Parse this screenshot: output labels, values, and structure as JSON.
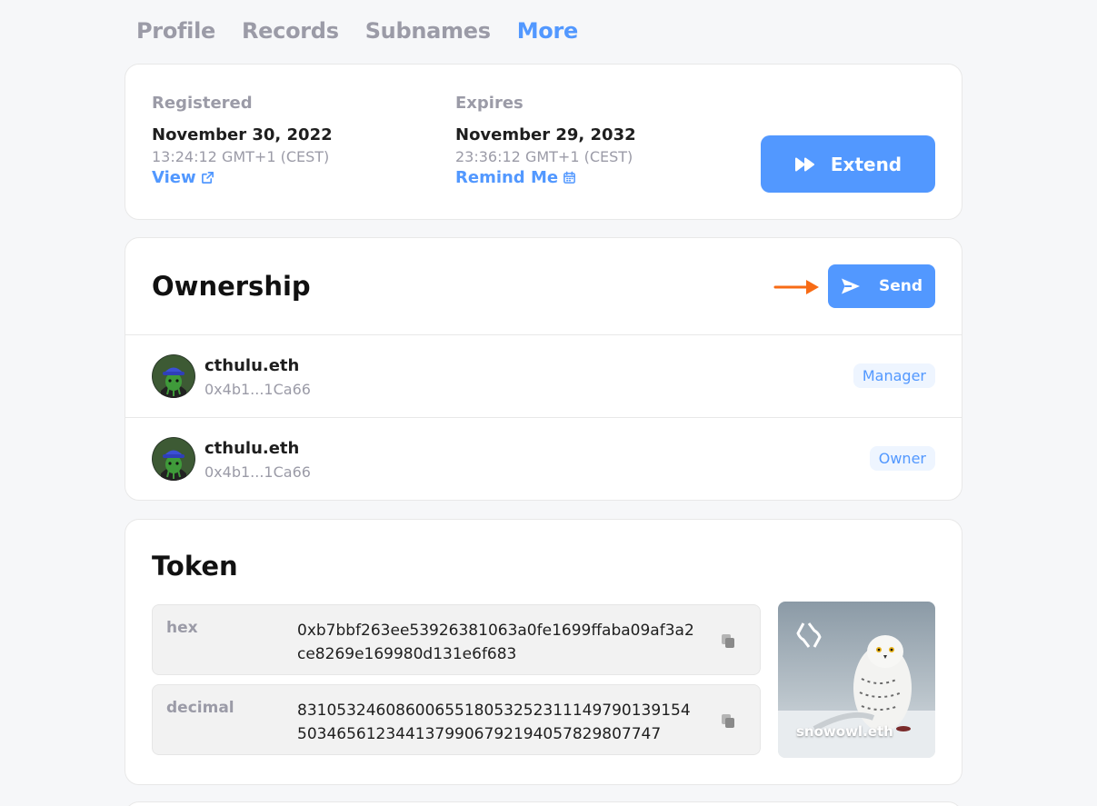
{
  "tabs": [
    {
      "label": "Profile",
      "active": false
    },
    {
      "label": "Records",
      "active": false
    },
    {
      "label": "Subnames",
      "active": false
    },
    {
      "label": "More",
      "active": true
    }
  ],
  "dates": {
    "registered": {
      "label": "Registered",
      "date": "November 30, 2022",
      "time": "13:24:12 GMT+1 (CEST)",
      "link_label": "View",
      "link_icon": "external-link-icon"
    },
    "expires": {
      "label": "Expires",
      "date": "November 29, 2032",
      "time": "23:36:12 GMT+1 (CEST)",
      "link_label": "Remind Me",
      "link_icon": "calendar-icon"
    },
    "extend_button": {
      "label": "Extend",
      "icon": "fast-forward-icon"
    }
  },
  "ownership": {
    "title": "Ownership",
    "send_button": {
      "label": "Send",
      "icon": "send-icon"
    },
    "owners": [
      {
        "name": "cthulu.eth",
        "address": "0x4b1...1Ca66",
        "role": "Manager"
      },
      {
        "name": "cthulu.eth",
        "address": "0x4b1...1Ca66",
        "role": "Owner"
      }
    ]
  },
  "token": {
    "title": "Token",
    "hex": {
      "label": "hex",
      "value": "0xb7bbf263ee53926381063a0fe1699ffaba09af3a2ce8269e169980d131e6f683"
    },
    "decimal": {
      "label": "decimal",
      "value": "83105324608600655180532523111497901391545034656123441379906792194057829807747"
    },
    "nft_name": "snowowl.eth"
  },
  "colors": {
    "accent": "#5298ff",
    "arrow": "#f76b15",
    "muted": "#9b9ba7"
  }
}
